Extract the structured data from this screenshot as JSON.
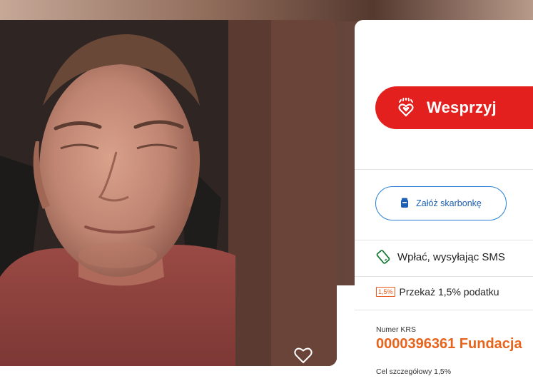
{
  "fundraiser": {
    "photo_alt": "fundraiser photo",
    "favorite_icon": "heart-outline-icon"
  },
  "donate": {
    "support_label": "Wesprzyj",
    "support_icon": "heart-hands-icon",
    "piggy_label": "Załóż skarbonkę",
    "piggy_icon": "jar-icon",
    "sms_label": "Wpłać, wysyłając SMS",
    "sms_icon": "phone-icon",
    "tax_badge": "1,5%",
    "tax_label": "Przekaż 1,5% podatku",
    "krs_label": "Numer KRS",
    "krs_value": "0000396361 Fundacja",
    "goal_label": "Cel szczegółowy 1,5%"
  },
  "colors": {
    "accent_red": "#e4201e",
    "accent_orange": "#e8641c",
    "accent_blue": "#2a7fd4"
  }
}
